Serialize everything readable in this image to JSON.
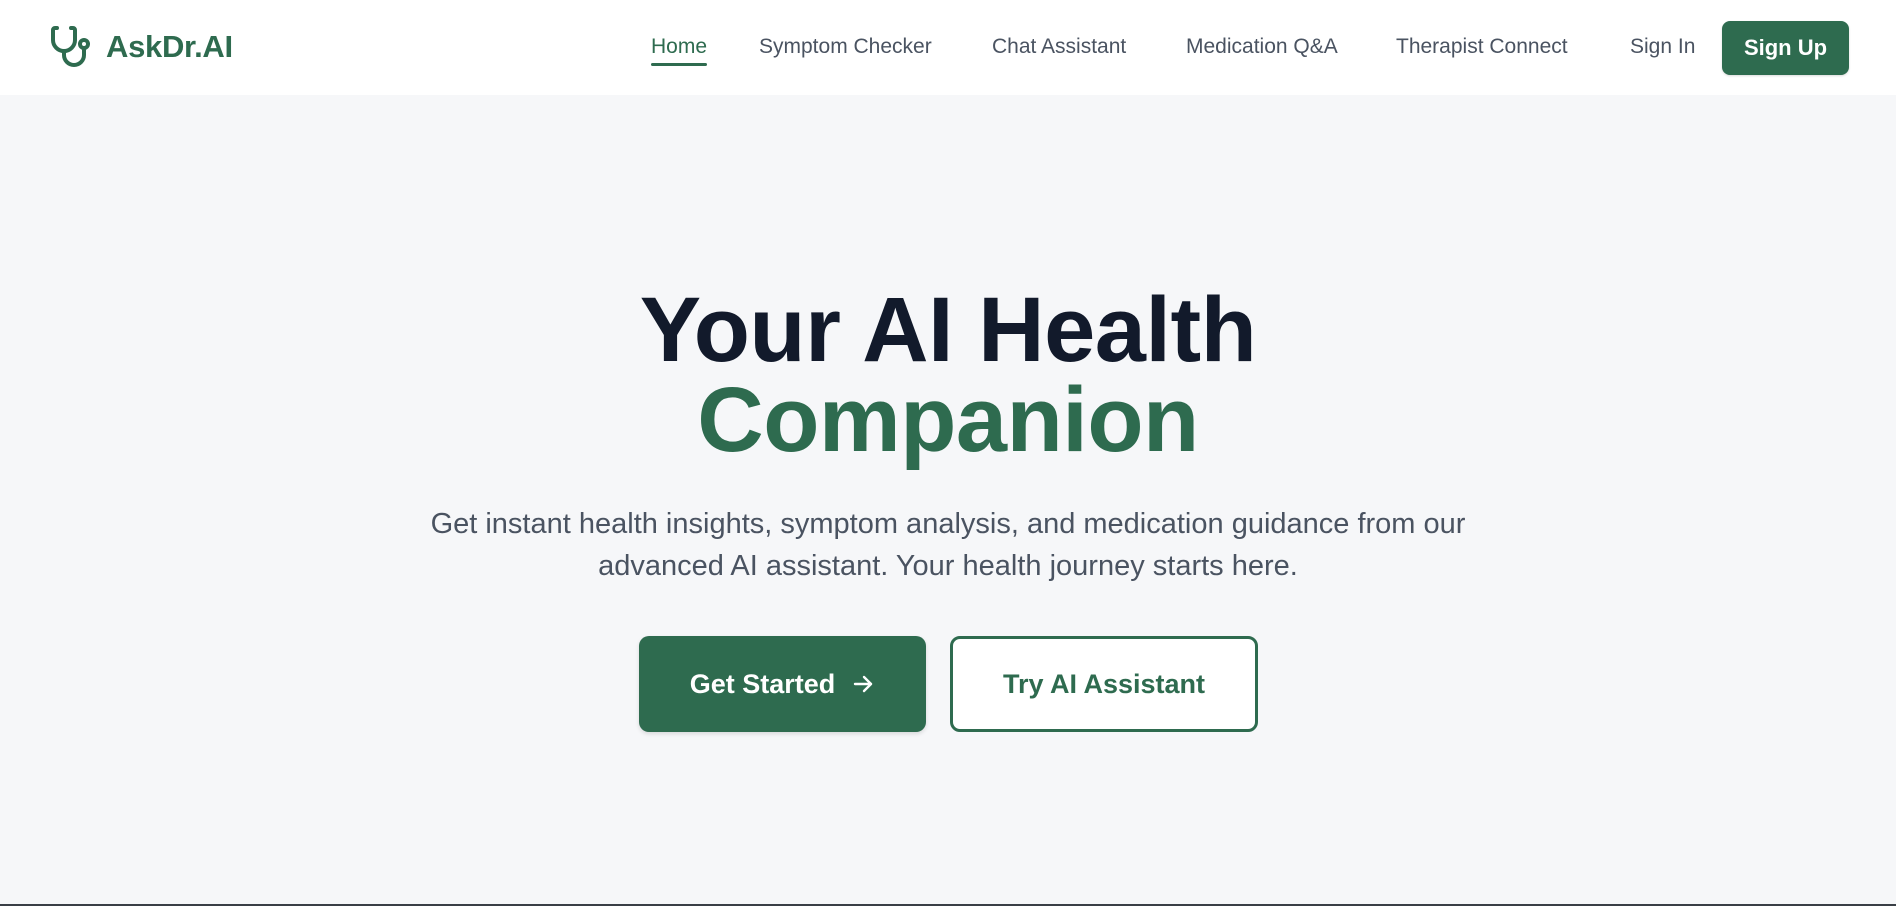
{
  "brand": {
    "name": "AskDr.AI",
    "icon": "stethoscope-icon",
    "color": "#2e6b4f"
  },
  "nav": {
    "items": [
      {
        "label": "Home",
        "active": true
      },
      {
        "label": "Symptom Checker",
        "active": false
      },
      {
        "label": "Chat Assistant",
        "active": false
      },
      {
        "label": "Medication Q&A",
        "active": false
      },
      {
        "label": "Therapist Connect",
        "active": false
      }
    ],
    "sign_in_label": "Sign In",
    "sign_up_label": "Sign Up"
  },
  "hero": {
    "title_line1": "Your AI Health",
    "title_line2": "Companion",
    "subtitle_line1": "Get instant health insights, symptom analysis, and medication guidance from our",
    "subtitle_line2": "advanced AI assistant. Your health journey starts here.",
    "primary_cta_label": "Get Started",
    "primary_cta_icon": "arrow-right-icon",
    "secondary_cta_label": "Try AI Assistant"
  },
  "colors": {
    "accent": "#2e6b4f",
    "heading": "#121a2b",
    "body_text": "#4a5361",
    "background": "#f6f7f9",
    "header_background": "#ffffff"
  }
}
